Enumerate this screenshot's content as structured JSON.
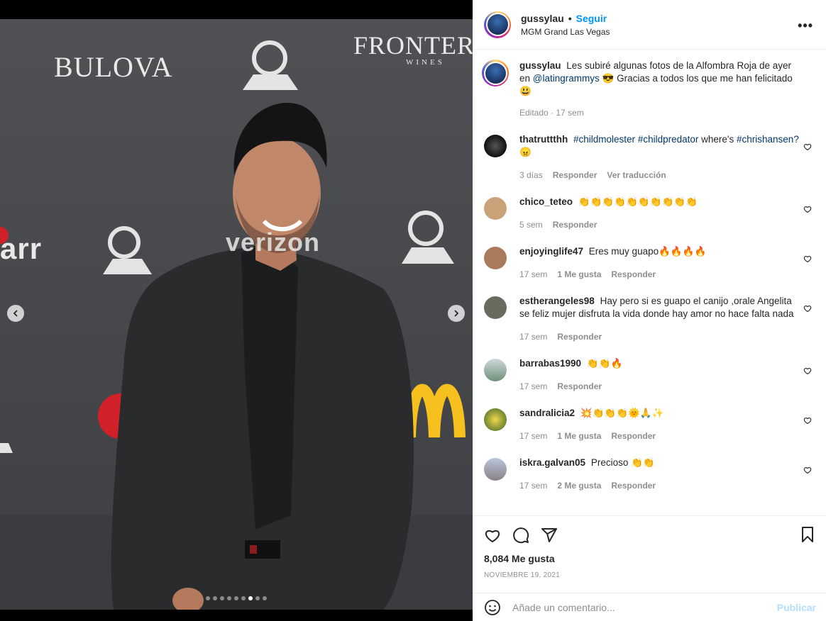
{
  "post": {
    "username": "gussylau",
    "follow_label": "Seguir",
    "location": "MGM Grand Las Vegas",
    "more_icon": "more-options-icon",
    "carousel": {
      "current_index": 7,
      "total": 9
    }
  },
  "photo": {
    "brands": [
      "BULOVA",
      "FRONTER",
      "WINES",
      "arr",
      "verizon",
      "M"
    ]
  },
  "caption": {
    "username": "gussylau",
    "text_part1": "Les subiré algunas fotos de la Alfombra Roja de ayer en",
    "mention": "@latingrammys",
    "text_part2": "😎 Gracias a todos los que me han felicitado 😃",
    "meta": "Editado · 17 sem"
  },
  "comments": [
    {
      "username": "thatruttthh",
      "tags": [
        "#childmolester",
        "#childpredator"
      ],
      "text": "where's",
      "tag2": "#chrishansen?",
      "emoji": "😠",
      "time": "3 días",
      "likes": "",
      "reply": "Responder",
      "translate": "Ver traducción",
      "avatar_color": "#2b2b2b"
    },
    {
      "username": "chico_teteo",
      "text": "👏👏👏👏👏👏👏👏👏👏",
      "time": "5 sem",
      "likes": "",
      "reply": "Responder",
      "avatar_color": "#c9a27a"
    },
    {
      "username": "enjoyinglife47",
      "text": "Eres muy guapo🔥🔥🔥🔥",
      "time": "17 sem",
      "likes": "1 Me gusta",
      "reply": "Responder",
      "avatar_color": "#a97a5c"
    },
    {
      "username": "estherangeles98",
      "text": "Hay pero si es guapo el canijo ,orale Angelita se feliz mujer disfruta la vida donde hay amor no hace falta nada",
      "time": "17 sem",
      "likes": "",
      "reply": "Responder",
      "avatar_color": "#6b6a5e"
    },
    {
      "username": "barrabas1990",
      "text": "👏👏🔥",
      "time": "17 sem",
      "likes": "",
      "reply": "Responder",
      "avatar_color": "#8fa39a"
    },
    {
      "username": "sandralicia2",
      "text": "💥👏👏👏🌞🙏✨",
      "time": "17 sem",
      "likes": "1 Me gusta",
      "reply": "Responder",
      "avatar_color": "#c9b13a"
    },
    {
      "username": "iskra.galvan05",
      "text": "Precioso 👏👏",
      "time": "17 sem",
      "likes": "2 Me gusta",
      "reply": "Responder",
      "avatar_color": "#9aa7b8"
    }
  ],
  "actions": {
    "likes_label": "8,084 Me gusta",
    "date": "NOVIEMBRE 19, 2021"
  },
  "composer": {
    "placeholder": "Añade un comentario...",
    "publish_label": "Publicar"
  }
}
